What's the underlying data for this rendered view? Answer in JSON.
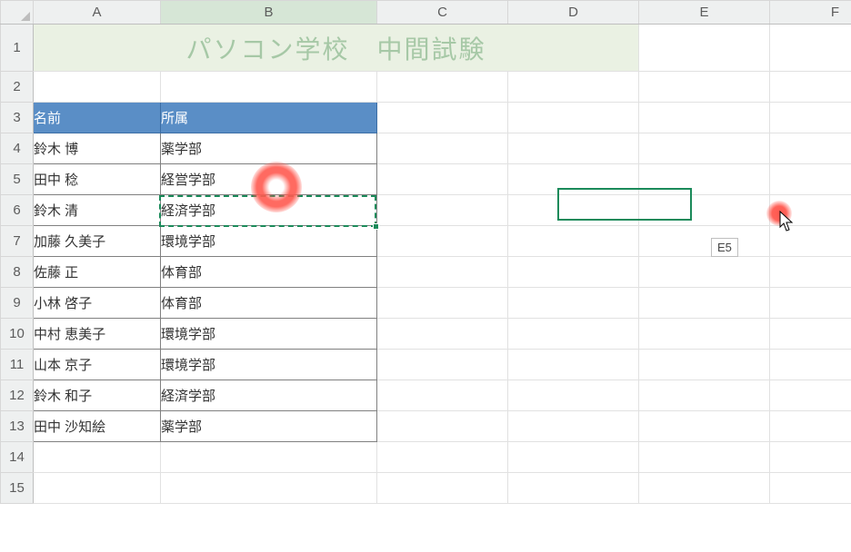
{
  "columns": [
    "A",
    "B",
    "C",
    "D",
    "E",
    "F"
  ],
  "row_numbers": [
    1,
    2,
    3,
    4,
    5,
    6,
    7,
    8,
    9,
    10,
    11,
    12,
    13,
    14,
    15
  ],
  "title": "パソコン学校　中間試験",
  "headers": {
    "name": "名前",
    "dept": "所属"
  },
  "rows": [
    {
      "name": "鈴木 博",
      "dept": "薬学部"
    },
    {
      "name": "田中 稔",
      "dept": "経営学部"
    },
    {
      "name": "鈴木 清",
      "dept": "経済学部"
    },
    {
      "name": "加藤 久美子",
      "dept": "環境学部"
    },
    {
      "name": "佐藤 正",
      "dept": "体育部"
    },
    {
      "name": "小林 啓子",
      "dept": "体育部"
    },
    {
      "name": "中村 恵美子",
      "dept": "環境学部"
    },
    {
      "name": "山本 京子",
      "dept": "環境学部"
    },
    {
      "name": "鈴木 和子",
      "dept": "経済学部"
    },
    {
      "name": "田中 沙知絵",
      "dept": "薬学部"
    }
  ],
  "active_cell_ref": "B5",
  "hover_tip": "E5"
}
